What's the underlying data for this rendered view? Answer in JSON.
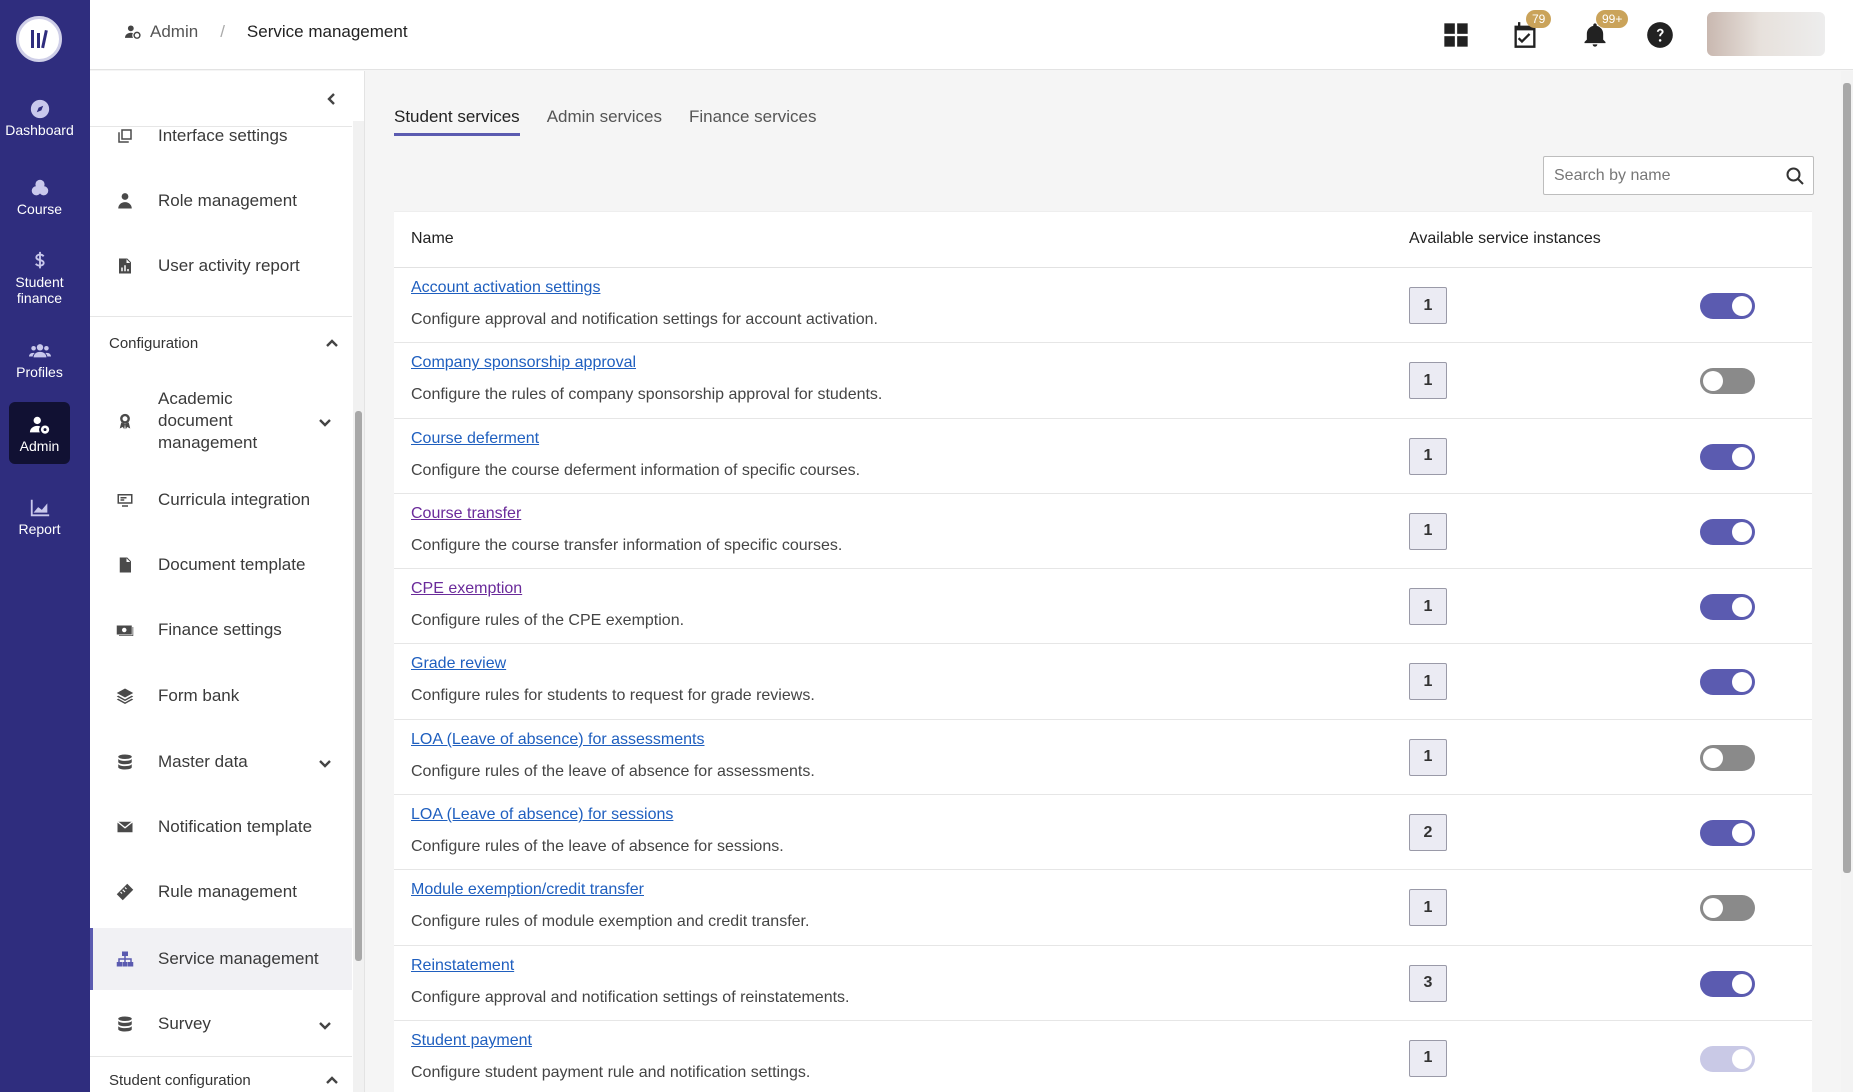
{
  "rail": {
    "items": [
      {
        "label": "Dashboard",
        "icon": "compass-icon"
      },
      {
        "label": "Course",
        "icon": "course-icon"
      },
      {
        "label": "Student finance",
        "icon": "dollar-icon"
      },
      {
        "label": "Profiles",
        "icon": "people-icon"
      },
      {
        "label": "Admin",
        "icon": "user-gear-icon",
        "active": true
      },
      {
        "label": "Report",
        "icon": "chart-icon"
      }
    ]
  },
  "breadcrumb": {
    "root": "Admin",
    "separator": "/",
    "current": "Service management"
  },
  "topbar": {
    "calendar_badge": "79",
    "bell_badge": "99+"
  },
  "sidenav": {
    "items_top": [
      {
        "label": "Interface settings",
        "icon": "windows-icon"
      },
      {
        "label": "Role management",
        "icon": "user-tie-icon"
      },
      {
        "label": "User activity report",
        "icon": "report-file-icon"
      }
    ],
    "config_heading": "Configuration",
    "config_items": [
      {
        "label": "Academic document management",
        "icon": "award-icon",
        "expandable": true
      },
      {
        "label": "Curricula integration",
        "icon": "monitor-icon"
      },
      {
        "label": "Document template",
        "icon": "file-icon"
      },
      {
        "label": "Finance settings",
        "icon": "money-icon"
      },
      {
        "label": "Form bank",
        "icon": "layers-icon"
      },
      {
        "label": "Master data",
        "icon": "database-icon",
        "expandable": true
      },
      {
        "label": "Notification template",
        "icon": "envelope-icon"
      },
      {
        "label": "Rule management",
        "icon": "ruler-icon"
      },
      {
        "label": "Service management",
        "icon": "sitemap-icon",
        "active": true
      },
      {
        "label": "Survey",
        "icon": "database-icon",
        "expandable": true
      }
    ],
    "student_config_heading": "Student configuration"
  },
  "tabs": [
    {
      "label": "Student services",
      "active": true
    },
    {
      "label": "Admin services"
    },
    {
      "label": "Finance services"
    }
  ],
  "search": {
    "placeholder": "Search by name",
    "value": ""
  },
  "table": {
    "columns": [
      "Name",
      "Available service instances"
    ],
    "rows": [
      {
        "name": "Account activation settings",
        "description": "Configure approval and notification settings for account activation.",
        "instances": "1",
        "enabled": true
      },
      {
        "name": "Company sponsorship approval",
        "description": "Configure the rules of company sponsorship approval for students.",
        "instances": "1",
        "enabled": false
      },
      {
        "name": "Course deferment",
        "description": "Configure the course deferment information of specific courses.",
        "instances": "1",
        "enabled": true
      },
      {
        "name": "Course transfer",
        "description": "Configure the course transfer information of specific courses.",
        "instances": "1",
        "enabled": true,
        "visited": true
      },
      {
        "name": "CPE exemption",
        "description": "Configure rules of the CPE exemption.",
        "instances": "1",
        "enabled": true,
        "visited": true
      },
      {
        "name": "Grade review",
        "description": "Configure rules for students to request for grade reviews.",
        "instances": "1",
        "enabled": true
      },
      {
        "name": "LOA (Leave of absence) for assessments",
        "description": "Configure rules of the leave of absence for assessments.",
        "instances": "1",
        "enabled": false
      },
      {
        "name": "LOA (Leave of absence) for sessions",
        "description": "Configure rules of the leave of absence for sessions.",
        "instances": "2",
        "enabled": true
      },
      {
        "name": "Module exemption/credit transfer",
        "description": "Configure rules of module exemption and credit transfer.",
        "instances": "1",
        "enabled": false
      },
      {
        "name": "Reinstatement",
        "description": "Configure approval and notification settings of reinstatements.",
        "instances": "3",
        "enabled": true
      },
      {
        "name": "Student payment",
        "description": "Configure student payment rule and notification settings.",
        "instances": "1",
        "enabled": true,
        "disabled": true
      }
    ]
  },
  "colors": {
    "rail": "#2f2d7e",
    "accent": "#5b5bb0",
    "link": "#1f5fbf",
    "visited_link": "#6a2a9a",
    "badge": "#caa35a"
  }
}
